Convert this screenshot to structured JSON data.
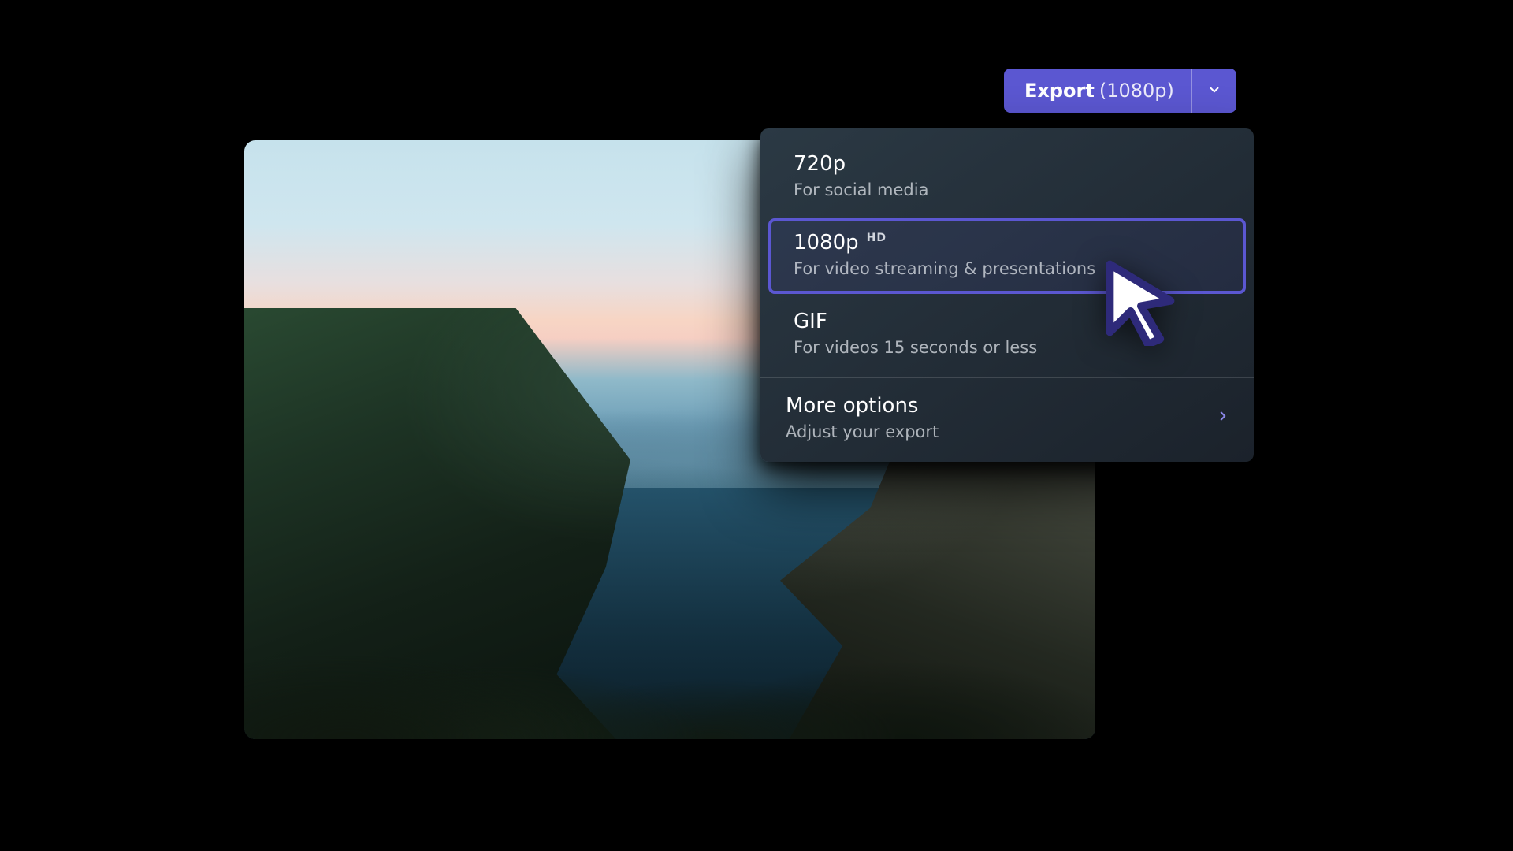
{
  "export_button": {
    "label": "Export",
    "current_setting": "(1080p)"
  },
  "menu": {
    "options": [
      {
        "title": "720p",
        "subtitle": "For social media"
      },
      {
        "title": "1080p",
        "subtitle": "For video streaming & presentations",
        "badge": "HD",
        "selected": true
      },
      {
        "title": "GIF",
        "subtitle": "For videos 15 seconds or less"
      }
    ],
    "more": {
      "title": "More options",
      "subtitle": "Adjust your export"
    }
  },
  "colors": {
    "accent": "#5B57D1",
    "panel_bg_from": "#2B3944",
    "panel_bg_to": "#1B222B"
  }
}
